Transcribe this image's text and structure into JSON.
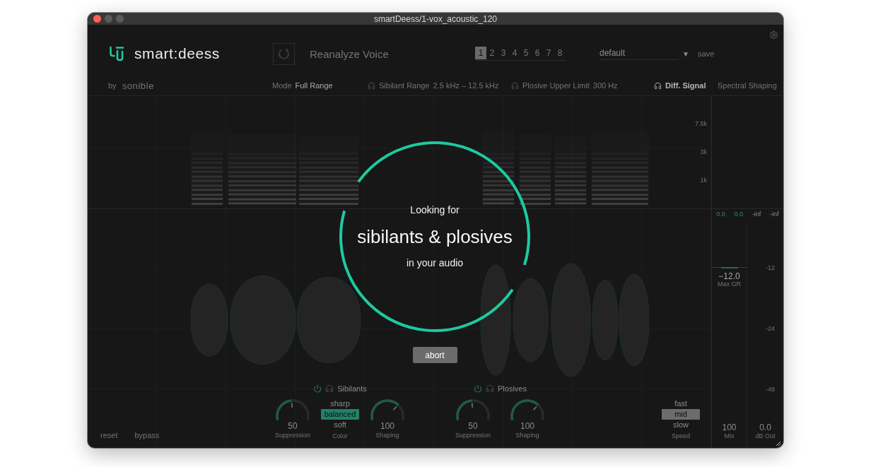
{
  "window": {
    "title": "smartDeess/1-vox_acoustic_120"
  },
  "header": {
    "logo": "smart:deess",
    "reanalyze": {
      "label": "Reanalyze Voice",
      "disabled": true
    },
    "slots": [
      {
        "label": "1",
        "selected": true
      },
      {
        "label": "2",
        "selected": false
      },
      {
        "label": "3",
        "selected": false
      },
      {
        "label": "4",
        "selected": false
      },
      {
        "label": "5",
        "selected": false
      },
      {
        "label": "6",
        "selected": false
      },
      {
        "label": "7",
        "selected": false
      },
      {
        "label": "8",
        "selected": false
      }
    ],
    "preset": {
      "value": "default",
      "arrow": "▼"
    },
    "save": "save"
  },
  "info_bar": {
    "by": "by",
    "brand": "sonible",
    "items": [
      {
        "kind": "mode",
        "label": "Mode",
        "value": "Full Range"
      },
      {
        "kind": "listen",
        "label": "Sibilant Range",
        "value": "2.5 kHz – 12.5 kHz",
        "selected": false
      },
      {
        "kind": "listen",
        "label": "Plosive Upper Limit",
        "value": "300 Hz",
        "selected": false
      },
      {
        "kind": "listen",
        "label": "Diff. Signal",
        "selected": true
      },
      {
        "kind": "link",
        "label": "Spectral Shaping"
      }
    ]
  },
  "spectrum": {
    "freq_labels": [
      "7.5k",
      "3k",
      "1k"
    ]
  },
  "analysis_overlay": {
    "intro": "Looking for",
    "headline": "sibilants & plosives",
    "outro": "in your audio",
    "abort": "abort"
  },
  "sections": [
    {
      "title": "Sibilants",
      "on": true,
      "listen": false,
      "controls": [
        {
          "kind": "knob",
          "value": "50",
          "label": "Suppression",
          "level": 0.5
        },
        {
          "kind": "selector",
          "label": "Color",
          "options": [
            {
              "label": "sharp",
              "selected": false
            },
            {
              "label": "balanced",
              "selected": true
            },
            {
              "label": "soft",
              "selected": false
            }
          ]
        },
        {
          "kind": "knob",
          "value": "100",
          "label": "Shaping",
          "level": 0.85
        }
      ]
    },
    {
      "title": "Plosives",
      "on": true,
      "listen": false,
      "controls": [
        {
          "kind": "knob",
          "value": "50",
          "label": "Suppression",
          "level": 0.5
        },
        {
          "kind": "knob",
          "value": "100",
          "label": "Shaping",
          "level": 0.85
        }
      ]
    }
  ],
  "speed": {
    "label": "Speed",
    "options": [
      {
        "label": "fast",
        "selected": false
      },
      {
        "label": "mid",
        "selected": true
      },
      {
        "label": "slow",
        "selected": false
      }
    ]
  },
  "footer": {
    "reset": "reset",
    "bypass": "bypass"
  },
  "meters": {
    "peaks": [
      {
        "kind": "reduction",
        "value": "0.0"
      },
      {
        "kind": "reduction",
        "value": "0.0"
      },
      {
        "kind": "level",
        "value": "-inf"
      },
      {
        "kind": "level",
        "value": "-inf"
      }
    ],
    "max_gr": {
      "value": "−12.0",
      "label": "Max GR"
    },
    "scale": [
      "-12",
      "-24",
      "-48"
    ],
    "mix": {
      "value": "100",
      "label": "Mix"
    },
    "output": {
      "value": "0.0",
      "label": "dB Out"
    }
  }
}
